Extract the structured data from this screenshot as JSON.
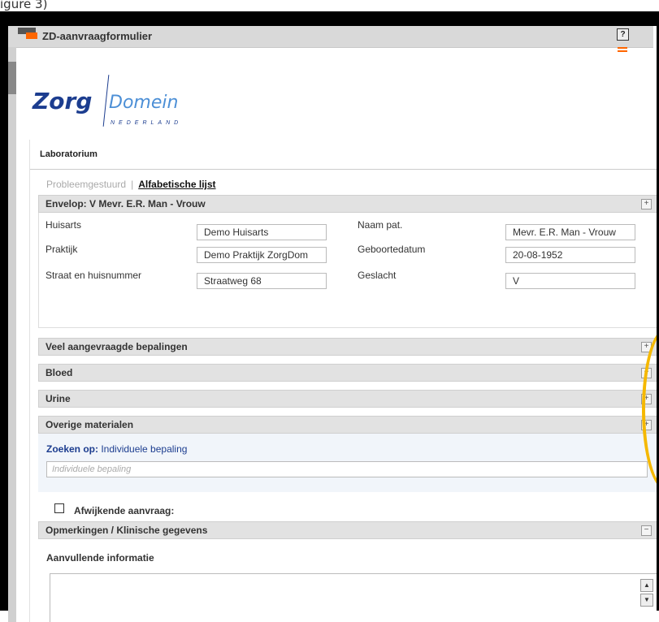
{
  "caption": "igure 3)",
  "window": {
    "title": "ZD-aanvraagformulier",
    "help_label": "?"
  },
  "brand": {
    "zorg": "Zorg",
    "domein": "Domein",
    "nederland": "NEDERLAND"
  },
  "tabs": [
    {
      "label": "Laboratorium"
    }
  ],
  "subnav": {
    "inactive": "Probleemgestuurd",
    "separator": "|",
    "active": "Alfabetische lijst"
  },
  "envelope": {
    "title": "Envelop: V Mevr. E.R. Man - Vrouw",
    "fields": [
      {
        "label": "Huisarts",
        "value": "Demo Huisarts"
      },
      {
        "label": "Praktijk",
        "value": "Demo Praktijk ZorgDom"
      },
      {
        "label": "Straat en huisnummer",
        "value": "Straatweg 68"
      },
      {
        "label": "Naam pat.",
        "value": "Mevr. E.R. Man - Vrouw"
      },
      {
        "label": "Geboortedatum",
        "value": "20-08-1952"
      },
      {
        "label": "Geslacht",
        "value": "V"
      }
    ]
  },
  "sections": [
    {
      "label": "Veel aangevraagde bepalingen",
      "toggle": "+"
    },
    {
      "label": "Bloed",
      "toggle": "+"
    },
    {
      "label": "Urine",
      "toggle": "+"
    },
    {
      "label": "Overige materialen",
      "toggle": "+"
    }
  ],
  "search": {
    "label_bold": "Zoeken op:",
    "label_rest": " Individuele bepaling",
    "placeholder": "Individuele bepaling"
  },
  "afwijkende": {
    "label": "Afwijkende aanvraag:"
  },
  "opmerkingen": {
    "title": "Opmerkingen / Klinische gegevens",
    "toggle": "−"
  },
  "aanvullende": {
    "label": "Aanvullende informatie"
  },
  "colors": {
    "orange_accent": "#ff6600",
    "highlight_oval": "#f5b800",
    "brand_blue": "#1c3d8f"
  }
}
